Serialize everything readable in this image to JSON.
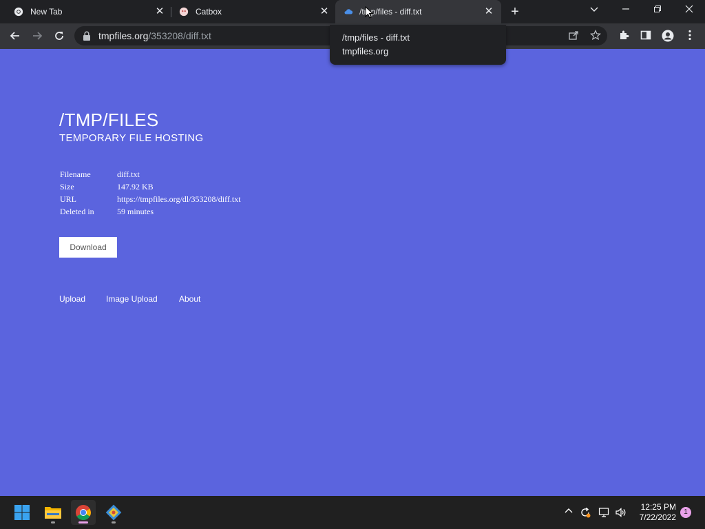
{
  "browser": {
    "tabs": [
      {
        "title": "New Tab",
        "icon": "chrome-icon",
        "active": false
      },
      {
        "title": "Catbox",
        "icon": "catbox-icon",
        "active": false
      },
      {
        "title": "/tmp/files - diff.txt",
        "icon": "cloud-icon",
        "active": true
      }
    ],
    "address": {
      "host": "tmpfiles.org",
      "path": "/353208/diff.txt"
    },
    "hover_card": {
      "title": "/tmp/files - diff.txt",
      "domain": "tmpfiles.org"
    }
  },
  "page": {
    "title": "/TMP/FILES",
    "subtitle": "TEMPORARY FILE HOSTING",
    "info": [
      {
        "key": "Filename",
        "value": "diff.txt"
      },
      {
        "key": "Size",
        "value": "147.92 KB"
      },
      {
        "key": "URL",
        "value": "https://tmpfiles.org/dl/353208/diff.txt"
      },
      {
        "key": "Deleted in",
        "value": "59 minutes"
      }
    ],
    "download_label": "Download",
    "footer_links": [
      "Upload",
      "Image Upload",
      "About"
    ],
    "background_color": "#5b64de"
  },
  "taskbar": {
    "apps": [
      "start-icon",
      "file-explorer-icon",
      "chrome-icon",
      "git-icon"
    ],
    "time": "12:25 PM",
    "date": "7/22/2022",
    "notification_count": "1"
  }
}
